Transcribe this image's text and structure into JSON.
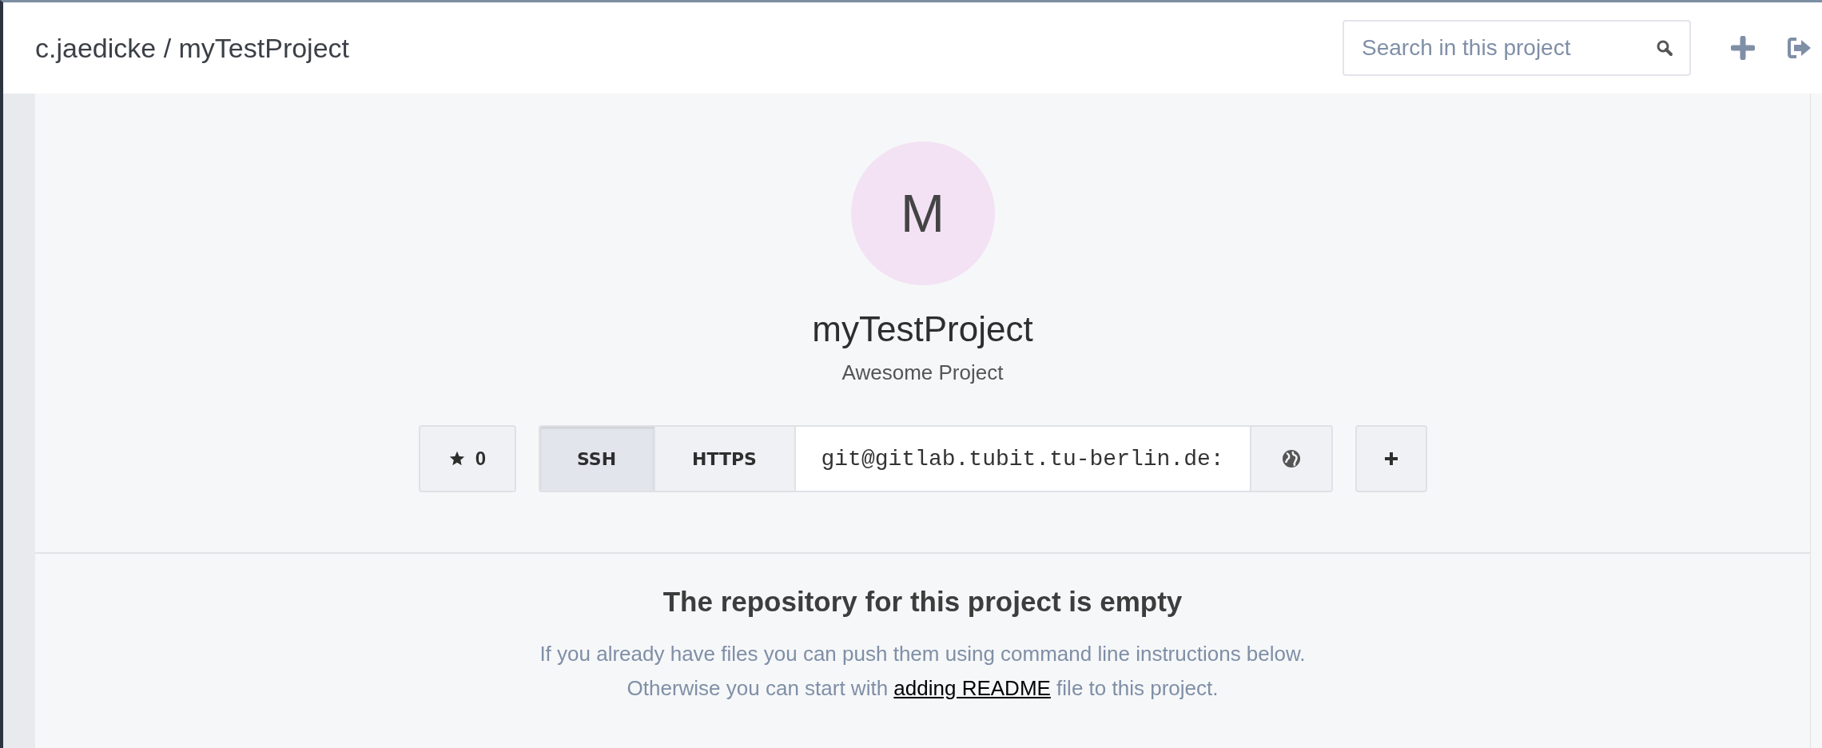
{
  "header": {
    "breadcrumb": "c.jaedicke / myTestProject",
    "search": {
      "placeholder": "Search in this project"
    }
  },
  "project": {
    "avatar_letter": "M",
    "name": "myTestProject",
    "description": "Awesome Project"
  },
  "star": {
    "count": "0"
  },
  "clone": {
    "protocols": [
      {
        "label": "SSH",
        "selected": true
      },
      {
        "label": "HTTPS",
        "selected": false
      }
    ],
    "url": "git@gitlab.tubit.tu-berlin.de:"
  },
  "empty_notice": {
    "title": "The repository for this project is empty",
    "line_1": "If you already have files you can push them using command line instructions below.",
    "line_2_before": "Otherwise you can start with ",
    "link": "adding README",
    "line_2_after": " file to this project."
  }
}
